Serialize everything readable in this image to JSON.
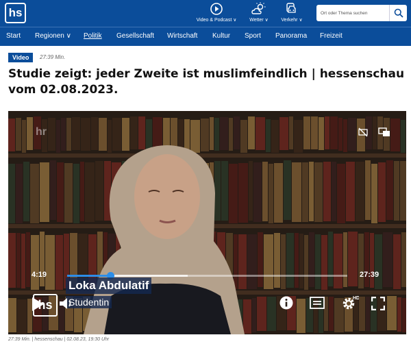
{
  "header": {
    "logo_text": "hs",
    "nav": [
      {
        "label": "Video & Podcast ∨",
        "icon": "play-circle-icon"
      },
      {
        "label": "Wetter ∨",
        "icon": "weather-sun-cloud-icon"
      },
      {
        "label": "Verkehr ∨",
        "icon": "car-traffic-icon"
      }
    ],
    "search": {
      "placeholder": "Ort oder Thema suchen"
    }
  },
  "menu": {
    "items": [
      {
        "label": "Start"
      },
      {
        "label": "Regionen ∨"
      },
      {
        "label": "Politik"
      },
      {
        "label": "Gesellschaft"
      },
      {
        "label": "Wirtschaft"
      },
      {
        "label": "Kultur"
      },
      {
        "label": "Sport"
      },
      {
        "label": "Panorama"
      },
      {
        "label": "Freizeit"
      }
    ]
  },
  "article": {
    "badge": "Video",
    "duration": "27:39 Min.",
    "title": "Studie zeigt: jeder Zweite ist muslimfeindlich | hessenschau vom 02.08.2023."
  },
  "player": {
    "watermark": "hr",
    "current_time": "4:19",
    "total_time": "27:39",
    "progress": 0.156,
    "buffered": 0.43,
    "lower_third_name": "Loka Abdulatif",
    "lower_third_role": "Studentin",
    "mini_logo": "hs",
    "hd_badge": "HD",
    "colors": {
      "accent": "#2b8de8",
      "brand": "#0b4d9a"
    }
  },
  "meta": {
    "line": "27:39 Min.  |  hessenschau  |  02.08.23, 19:30 Uhr"
  }
}
